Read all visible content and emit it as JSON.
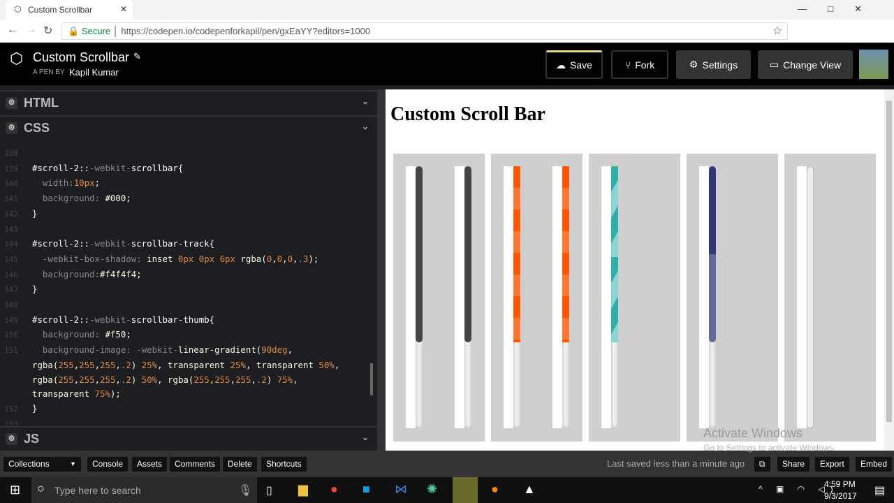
{
  "browser": {
    "tab_title": "Custom Scrollbar",
    "secure": "Secure",
    "url": "https://codepen.io/codepenforkapil/pen/gxEaYY?editors=1000"
  },
  "pen": {
    "title": "Custom Scrollbar",
    "by_label": "A PEN BY",
    "author": "Kapil Kumar"
  },
  "header_buttons": {
    "save": "Save",
    "fork": "Fork",
    "settings": "Settings",
    "change_view": "Change View"
  },
  "panes": {
    "html": "HTML",
    "css": "CSS",
    "js": "JS"
  },
  "code_lines": [
    {
      "n": "138",
      "t": []
    },
    {
      "n": "139",
      "t": [
        [
          "#scroll-2::",
          "sel"
        ],
        [
          "-webkit-",
          "dim"
        ],
        [
          "scrollbar{",
          "sel"
        ]
      ]
    },
    {
      "n": "140",
      "t": [
        [
          "  width:",
          "dim"
        ],
        [
          "10px",
          "num"
        ],
        [
          ";",
          "val"
        ]
      ]
    },
    {
      "n": "141",
      "t": [
        [
          "  background: ",
          "dim"
        ],
        [
          "#000;",
          "val"
        ]
      ]
    },
    {
      "n": "142",
      "t": [
        [
          "}",
          "val"
        ]
      ]
    },
    {
      "n": "143",
      "t": []
    },
    {
      "n": "144",
      "t": [
        [
          "#scroll-2::",
          "sel"
        ],
        [
          "-webkit-",
          "dim"
        ],
        [
          "scrollbar-track{",
          "sel"
        ]
      ]
    },
    {
      "n": "145",
      "t": [
        [
          "  -webkit-box-shadow: ",
          "dim"
        ],
        [
          "inset ",
          "val"
        ],
        [
          "0px 0px 6px ",
          "num"
        ],
        [
          "rgba(",
          "val"
        ],
        [
          "0",
          "num"
        ],
        [
          ",",
          "val"
        ],
        [
          "0",
          "num"
        ],
        [
          ",",
          "val"
        ],
        [
          "0",
          "num"
        ],
        [
          ",",
          "val"
        ],
        [
          ".3",
          "num"
        ],
        [
          ");",
          "val"
        ]
      ]
    },
    {
      "n": "146",
      "t": [
        [
          "  background:",
          "dim"
        ],
        [
          "#f4f4f4;",
          "val"
        ]
      ]
    },
    {
      "n": "147",
      "t": [
        [
          "}",
          "val"
        ]
      ]
    },
    {
      "n": "148",
      "t": []
    },
    {
      "n": "149",
      "t": [
        [
          "#scroll-2::",
          "sel"
        ],
        [
          "-webkit-",
          "dim"
        ],
        [
          "scrollbar-thumb{",
          "sel"
        ]
      ]
    },
    {
      "n": "150",
      "t": [
        [
          "  background: ",
          "dim"
        ],
        [
          "#f50;",
          "val"
        ]
      ]
    },
    {
      "n": "151",
      "t": [
        [
          "  background-image: ",
          "dim"
        ],
        [
          "-webkit-",
          "dim"
        ],
        [
          "linear-gradient(",
          "val"
        ],
        [
          "90deg",
          "num"
        ],
        [
          ",",
          "val"
        ]
      ]
    },
    {
      "n": "",
      "t": [
        [
          "rgba(",
          "val"
        ],
        [
          "255",
          "num"
        ],
        [
          ",",
          "val"
        ],
        [
          "255",
          "num"
        ],
        [
          ",",
          "val"
        ],
        [
          "255",
          "num"
        ],
        [
          ",",
          "val"
        ],
        [
          ".2",
          "num"
        ],
        [
          ") ",
          "val"
        ],
        [
          "25%",
          "num"
        ],
        [
          ", transparent ",
          "val"
        ],
        [
          "25%",
          "num"
        ],
        [
          ", transparent ",
          "val"
        ],
        [
          "50%",
          "num"
        ],
        [
          ",",
          "val"
        ]
      ]
    },
    {
      "n": "",
      "t": [
        [
          "rgba(",
          "val"
        ],
        [
          "255",
          "num"
        ],
        [
          ",",
          "val"
        ],
        [
          "255",
          "num"
        ],
        [
          ",",
          "val"
        ],
        [
          "255",
          "num"
        ],
        [
          ",",
          "val"
        ],
        [
          ".2",
          "num"
        ],
        [
          ") ",
          "val"
        ],
        [
          "50%",
          "num"
        ],
        [
          ", rgba(",
          "val"
        ],
        [
          "255",
          "num"
        ],
        [
          ",",
          "val"
        ],
        [
          "255",
          "num"
        ],
        [
          ",",
          "val"
        ],
        [
          "255",
          "num"
        ],
        [
          ",",
          "val"
        ],
        [
          ".2",
          "num"
        ],
        [
          ") ",
          "val"
        ],
        [
          "75%",
          "num"
        ],
        [
          ",",
          "val"
        ]
      ]
    },
    {
      "n": "",
      "t": [
        [
          "transparent ",
          "val"
        ],
        [
          "75%",
          "num"
        ],
        [
          ");",
          "val"
        ]
      ]
    },
    {
      "n": "152",
      "t": [
        [
          "}",
          "val"
        ]
      ]
    },
    {
      "n": "153",
      "t": []
    }
  ],
  "preview": {
    "heading": "Custom Scroll Bar",
    "thumb_colors": [
      "#444444",
      "#ff5500",
      "#2cb0aa",
      "#2c3a7a",
      "#eeeeee"
    ]
  },
  "watermark": {
    "line1": "Activate Windows",
    "line2": "Go to Settings to activate Windows."
  },
  "footer": {
    "left": [
      "Collections",
      "Console",
      "Assets",
      "Comments",
      "Delete",
      "Shortcuts"
    ],
    "status": "Last saved less than a minute ago",
    "right": [
      "Share",
      "Export",
      "Embed"
    ]
  },
  "taskbar": {
    "search_placeholder": "Type here to search",
    "time": "4:59 PM",
    "date": "9/3/2017"
  }
}
